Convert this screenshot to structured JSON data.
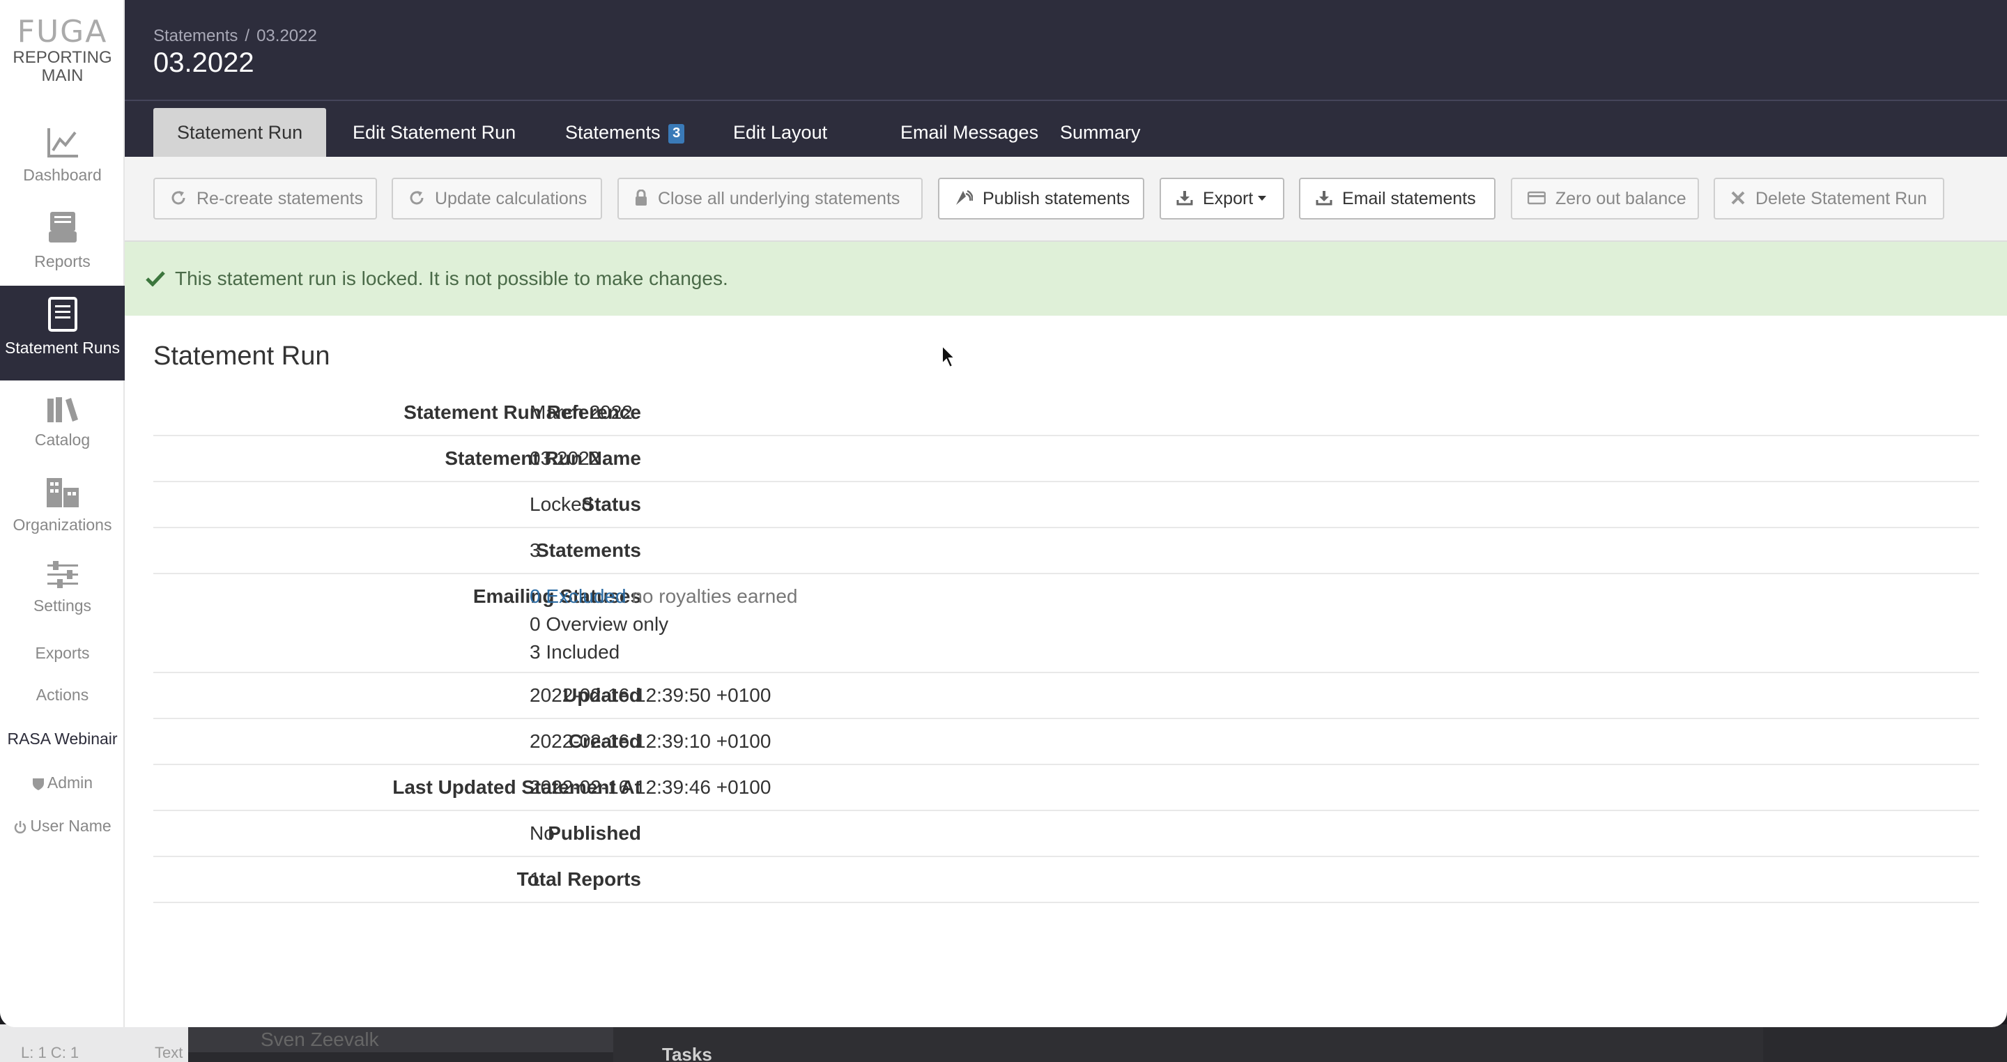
{
  "desktop": {
    "status_text": "L: 1 C: 1",
    "text_label": "Text",
    "user_name": "Sven Zeevalk",
    "tasks_label": "Tasks"
  },
  "sidebar": {
    "logo_mark": "FUGA",
    "logo_line1": "REPORTING",
    "logo_line2": "MAIN",
    "items": [
      {
        "label": "Dashboard",
        "icon": "line-chart-icon"
      },
      {
        "label": "Reports",
        "icon": "inbox-icon"
      },
      {
        "label": "Statement Runs",
        "icon": "document-icon",
        "active": true
      },
      {
        "label": "Catalog",
        "icon": "books-icon"
      },
      {
        "label": "Organizations",
        "icon": "building-icon"
      },
      {
        "label": "Settings",
        "icon": "sliders-icon"
      }
    ],
    "text_items": [
      "Exports",
      "Actions",
      "RASA Webinair",
      "Admin",
      "User Name"
    ]
  },
  "header": {
    "breadcrumb_root": "Statements",
    "breadcrumb_sep": "/",
    "breadcrumb_current": "03.2022",
    "title": "03.2022"
  },
  "tabs": [
    {
      "label": "Statement Run",
      "active": true
    },
    {
      "label": "Edit Statement Run"
    },
    {
      "label": "Statements",
      "badge": "3"
    },
    {
      "label": "Edit Layout"
    },
    {
      "label": "Email Messages"
    },
    {
      "label": "Summary"
    }
  ],
  "toolbar": {
    "recreate": "Re-create statements",
    "update": "Update calculations",
    "close_all": "Close all underlying statements",
    "publish": "Publish statements",
    "export": "Export",
    "email": "Email statements",
    "zero_out": "Zero out balance",
    "delete": "Delete Statement Run"
  },
  "alert": {
    "message": "This statement run is locked. It is not possible to make changes."
  },
  "section_title": "Statement Run",
  "details": {
    "reference_label": "Statement Run Reference",
    "reference_value": "March 2022",
    "name_label": "Statement Run Name",
    "name_value": "03.2022",
    "status_label": "Status",
    "status_value": "Locked",
    "statements_label": "Statements",
    "statements_value": "3",
    "emailing_label": "Emailing Statuses",
    "excluded_link": "0 Excluded",
    "excluded_note": "no royalties earned",
    "overview_link": "0 Overview only",
    "included_link": "3 Included",
    "updated_label": "Updated",
    "updated_value": "2022-02-16 12:39:50 +0100",
    "created_label": "Created",
    "created_value": "2022-02-16 12:39:10 +0100",
    "last_updated_label": "Last Updated Statement At",
    "last_updated_value": "2022-02-16 12:39:46 +0100",
    "published_label": "Published",
    "published_value": "No",
    "total_reports_label": "Total Reports",
    "total_reports_value": "1"
  }
}
